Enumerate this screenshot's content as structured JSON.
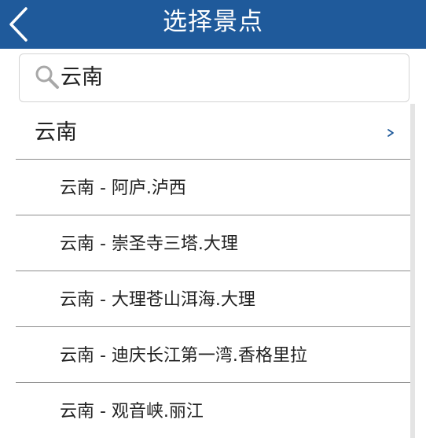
{
  "header": {
    "title": "选择景点"
  },
  "search": {
    "value": "云南"
  },
  "list": {
    "group_label": "云南",
    "items": [
      {
        "label": "云南 - 阿庐.泸西"
      },
      {
        "label": "云南 - 崇圣寺三塔.大理"
      },
      {
        "label": "云南 - 大理苍山洱海.大理"
      },
      {
        "label": "云南 - 迪庆长江第一湾.香格里拉"
      },
      {
        "label": "云南 - 观音峡.丽江"
      }
    ]
  },
  "colors": {
    "header_bg": "#1f5a9b",
    "chevron": "#1f5a9b",
    "divider": "#8d8d8d"
  },
  "icons": {
    "back": "chevron-left-icon",
    "search": "magnifier-icon",
    "group": "chevron-right-icon"
  }
}
